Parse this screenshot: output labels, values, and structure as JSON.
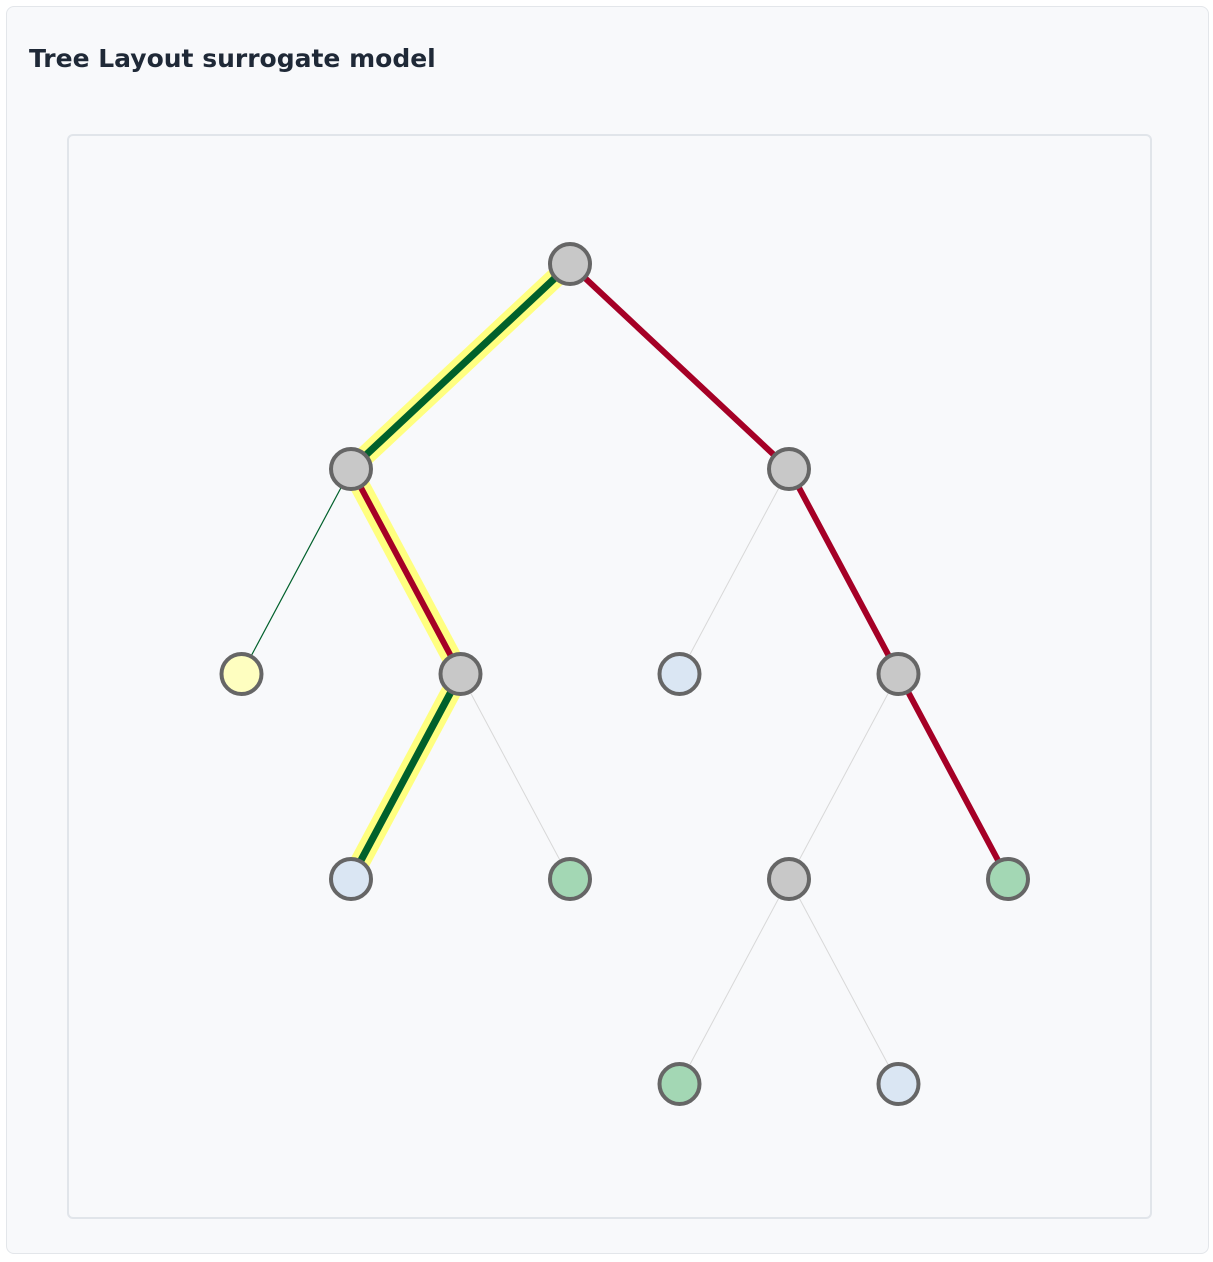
{
  "header": {
    "title": "Tree Layout surrogate model"
  },
  "colors": {
    "card_background": "#f8f9fb",
    "node_stroke": "#666666",
    "path_green": "#00602b",
    "path_red": "#a50026",
    "path_highlight": "#ffff80",
    "faint_edge": "#d8d8d8",
    "node_inner": "#c8c8c8",
    "node_leaf_blue": "#dae6f3",
    "node_leaf_green": "#a3d7b4",
    "node_leaf_yellow": "#fefec0"
  },
  "tree": {
    "depth_levels": 5,
    "nodes": [
      {
        "id": "n0",
        "depth": 0,
        "order": 4,
        "kind": "inner"
      },
      {
        "id": "n1",
        "depth": 1,
        "order": 2,
        "kind": "inner"
      },
      {
        "id": "n2",
        "depth": 1,
        "order": 6,
        "kind": "inner"
      },
      {
        "id": "n3",
        "depth": 2,
        "order": 1,
        "kind": "leaf-yellow"
      },
      {
        "id": "n4",
        "depth": 2,
        "order": 3,
        "kind": "inner"
      },
      {
        "id": "n5",
        "depth": 2,
        "order": 5,
        "kind": "leaf-blue"
      },
      {
        "id": "n6",
        "depth": 2,
        "order": 7,
        "kind": "inner"
      },
      {
        "id": "n7",
        "depth": 3,
        "order": 2,
        "kind": "leaf-blue"
      },
      {
        "id": "n8",
        "depth": 3,
        "order": 4,
        "kind": "leaf-green"
      },
      {
        "id": "n9",
        "depth": 3,
        "order": 6,
        "kind": "inner"
      },
      {
        "id": "n10",
        "depth": 3,
        "order": 8,
        "kind": "leaf-green"
      },
      {
        "id": "n11",
        "depth": 4,
        "order": 5,
        "kind": "leaf-green"
      },
      {
        "id": "n12",
        "depth": 4,
        "order": 7,
        "kind": "leaf-blue"
      }
    ],
    "edges": [
      {
        "from": "n0",
        "to": "n1",
        "color": "green",
        "width": 0.72,
        "highlight": true
      },
      {
        "from": "n0",
        "to": "n2",
        "color": "red",
        "width": 0.6,
        "highlight": false
      },
      {
        "from": "n1",
        "to": "n3",
        "color": "green",
        "width": 0.12,
        "highlight": false
      },
      {
        "from": "n1",
        "to": "n4",
        "color": "red",
        "width": 0.6,
        "highlight": true
      },
      {
        "from": "n2",
        "to": "n5",
        "color": "faint",
        "width": 0.05,
        "highlight": false
      },
      {
        "from": "n2",
        "to": "n6",
        "color": "red",
        "width": 0.6,
        "highlight": false
      },
      {
        "from": "n4",
        "to": "n7",
        "color": "green",
        "width": 0.72,
        "highlight": true
      },
      {
        "from": "n4",
        "to": "n8",
        "color": "faint",
        "width": 0.05,
        "highlight": false
      },
      {
        "from": "n6",
        "to": "n9",
        "color": "faint",
        "width": 0.05,
        "highlight": false
      },
      {
        "from": "n6",
        "to": "n10",
        "color": "red",
        "width": 0.6,
        "highlight": false
      },
      {
        "from": "n9",
        "to": "n11",
        "color": "faint",
        "width": 0.05,
        "highlight": false
      },
      {
        "from": "n9",
        "to": "n12",
        "color": "faint",
        "width": 0.05,
        "highlight": false
      }
    ]
  }
}
